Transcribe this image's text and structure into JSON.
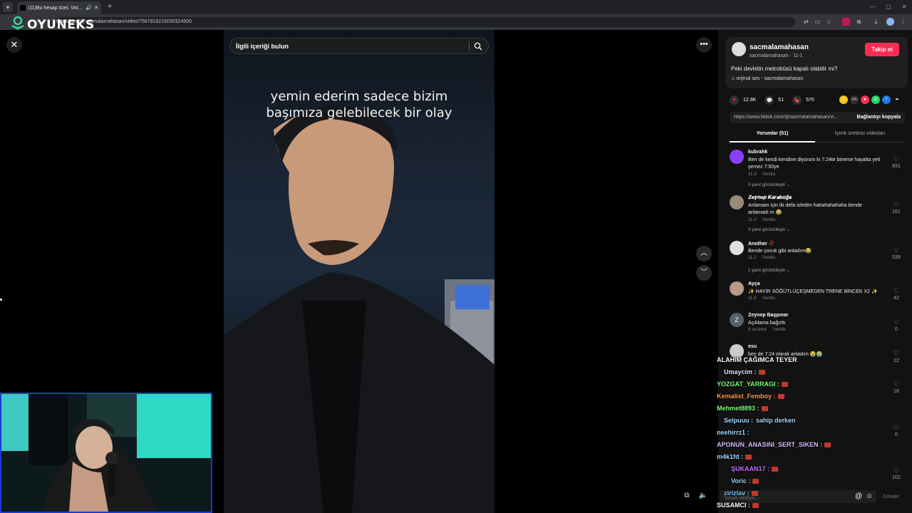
{
  "browser": {
    "tab_title": "(11)Bu hesap özel. Videola",
    "new_tab": "+",
    "url_prefix": "tiktok.com",
    "url_rest": "/@sacmalamahasan/video/7567819215030324500"
  },
  "overlay_logo": {
    "text": "OYUNEKS"
  },
  "video": {
    "search_placeholder": "İlgili içeriği bulun",
    "caption_line1": "yemin ederim sadece bizim",
    "caption_line2": "başımıza gelebilecek bir olay"
  },
  "author": {
    "name": "sacmalamahasan",
    "sub": "sacmalamahasan · 11-1",
    "follow_label": "Takip et",
    "description": "Peki devletin metrobüsü kapalı olabilir mi?",
    "music": "♫  orijinal ses - sacmalamahasan"
  },
  "stats": {
    "likes": "12.9K",
    "comments": "51",
    "saves": "570"
  },
  "link": {
    "url": "https://www.tiktok.com/@sacmalamahasan/vi...",
    "copy_label": "Bağlantıyı kopyala"
  },
  "tabs": {
    "comments": "Yorumlar (51)",
    "creator_videos": "İçerik üreticisi videoları"
  },
  "comments": [
    {
      "name": "kubrahk",
      "text": "Ben de kendi kendine diyorum ki 7:24te binerse hayatta yeti şemez 7:50ye",
      "date": "11-3",
      "reply": "Yanıtla",
      "more": "5 yanıt görüntüleyin ⌄",
      "likes": "831",
      "color": "#8a3ffc"
    },
    {
      "name": "𝒁𝒆𝒚𝒏𝒆𝒑 𝑲𝒂𝒓𝒂𝒃𝒖𝒈̆𝒂",
      "text": "Anlamam için iki defa izledim hahahahahaha bende anlamadı m 😂",
      "date": "11-2",
      "reply": "Yanıtla",
      "more": "3 yanıt görüntüleyin ⌄",
      "likes": "161",
      "color": "#9a8a7a"
    },
    {
      "name": "Another 🥀",
      "text": "Bende çocuk gibi anladım😂",
      "date": "11-2",
      "reply": "Yanıtla",
      "more": "1 yanıt görüntüleyin ⌄",
      "likes": "539",
      "color": "#e0e0e0"
    },
    {
      "name": "Ayça",
      "text": "✨ HAYIR SÖĞÜTLÜÇEŞMEDEN TRENE BİNCEK X2 ✨",
      "date": "11-9",
      "reply": "Yanıtla",
      "more": "",
      "likes": "42",
      "color": "#b89a8a"
    },
    {
      "name": "Zeynep Başpınar",
      "text": "Açıklama bağırttı",
      "date": "8 sa önce",
      "reply": "Yanıtla",
      "more": "",
      "likes": "0",
      "color": "#556068",
      "initial": "Z"
    },
    {
      "name": "esu",
      "text": "ben de 7:24 olarak anladım 😭😭",
      "date": "",
      "reply": "",
      "more": "",
      "likes": "22",
      "color": "#cccccc"
    }
  ],
  "hidden_likes": [
    "18",
    "0",
    "102"
  ],
  "chat": [
    {
      "user": "ALAHIM ÇAĞIMCA TEYER",
      "color": "#ffffff"
    },
    {
      "user": "Umaycim :",
      "color": "#e6d9ff"
    },
    {
      "user": "YOZGAT_YARRAGI :",
      "color": "#7cff7c"
    },
    {
      "user": "Kemalist_Femboy :",
      "color": "#ff9a4a"
    },
    {
      "user": "Mehmet8893 :",
      "color": "#7cff7c"
    },
    {
      "user": "Selpuuu :",
      "color": "#9fd8ff"
    },
    {
      "user": "sahip derken",
      "color": "#ffffff"
    },
    {
      "user": "neehirrz1 :",
      "color": "#9fd8ff"
    },
    {
      "user": "APONUN_ANASINI_SERT_SIKEN :",
      "color": "#d7b8ff"
    },
    {
      "user": "m4k1fd :",
      "color": "#9fd8ff"
    },
    {
      "user": "ŞUKAAN17 :",
      "color": "#c86bff"
    },
    {
      "user": "Voric :",
      "color": "#9fd8ff"
    },
    {
      "user": "zirizlav :",
      "color": "#7cc7ff"
    },
    {
      "user": "SUSAMCI :",
      "color": "#ffffff"
    }
  ],
  "composer": {
    "placeholder": "Yorum ekleyin...",
    "send_label": "Gönder"
  }
}
